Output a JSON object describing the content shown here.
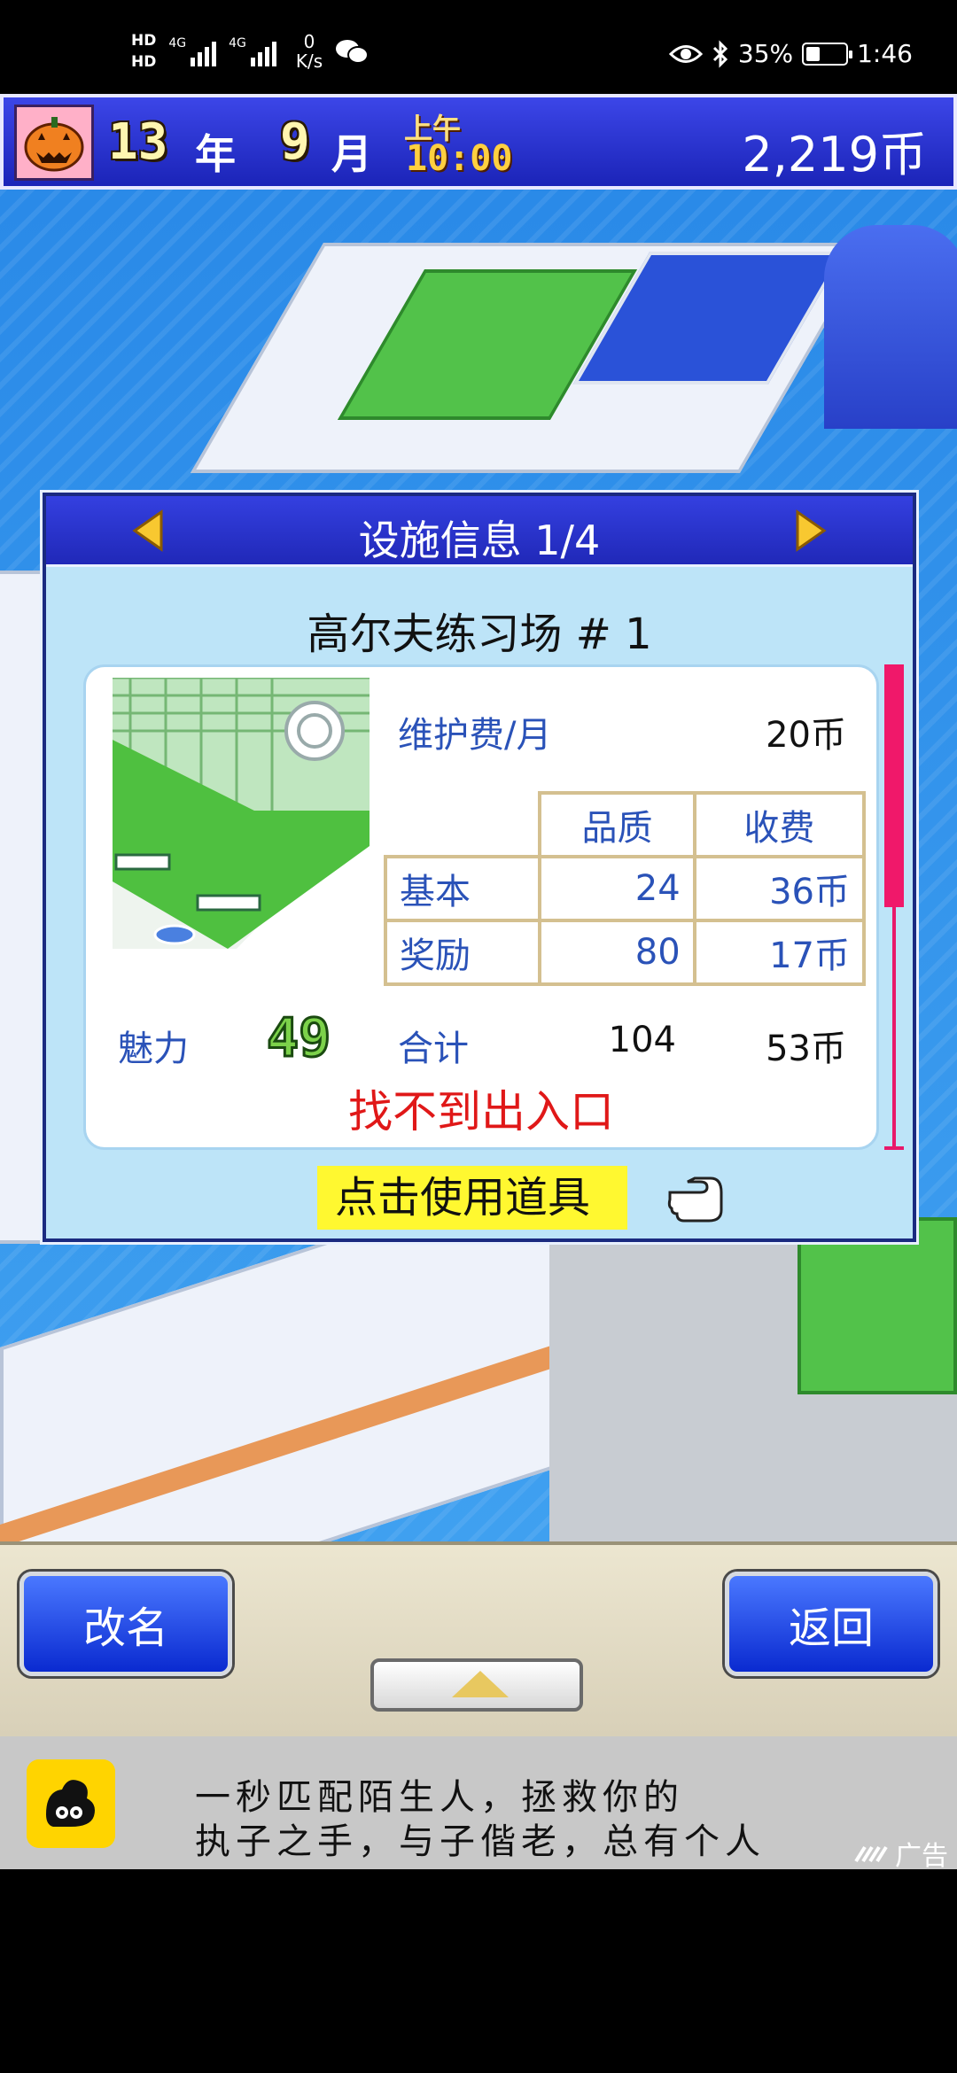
{
  "status_bar": {
    "hd1": "HD",
    "hd2": "HD",
    "sim1_type": "4G",
    "sim2_type": "4G",
    "net_speed_value": "0",
    "net_speed_unit": "K/s",
    "battery_percent": "35%",
    "battery_level": 0.35,
    "time": "1:46",
    "icons": [
      "wechat-icon",
      "eye-icon",
      "bluetooth-icon",
      "battery-icon"
    ]
  },
  "game_bar": {
    "year_num": "13",
    "year_unit": "年",
    "month_num": "9",
    "month_unit": "月",
    "ampm": "上午",
    "time": "10:00",
    "coins": "2,219币"
  },
  "panel": {
    "title": "设施信息 1/4",
    "facility_name": "高尔夫练习场 # 1",
    "maintenance_label": "维护费/月",
    "maintenance_value": "20币",
    "table": {
      "headers": [
        "品质",
        "收费"
      ],
      "rows": [
        {
          "label": "基本",
          "quality": "24",
          "fee": "36币"
        },
        {
          "label": "奖励",
          "quality": "80",
          "fee": "17币"
        }
      ]
    },
    "charm_label": "魅力",
    "charm_value": "49",
    "total_label": "合计",
    "total_quality": "104",
    "total_fee": "53币",
    "warning": "找不到出入口",
    "use_item": "点击使用道具",
    "scroll_fraction": 0.5
  },
  "toolbar": {
    "rename_label": "改名",
    "back_label": "返回"
  },
  "ad": {
    "line1": "一秒匹配陌生人，拯救你的",
    "line2": "执子之手，与子偕老，总有个人",
    "tag": "广告"
  }
}
